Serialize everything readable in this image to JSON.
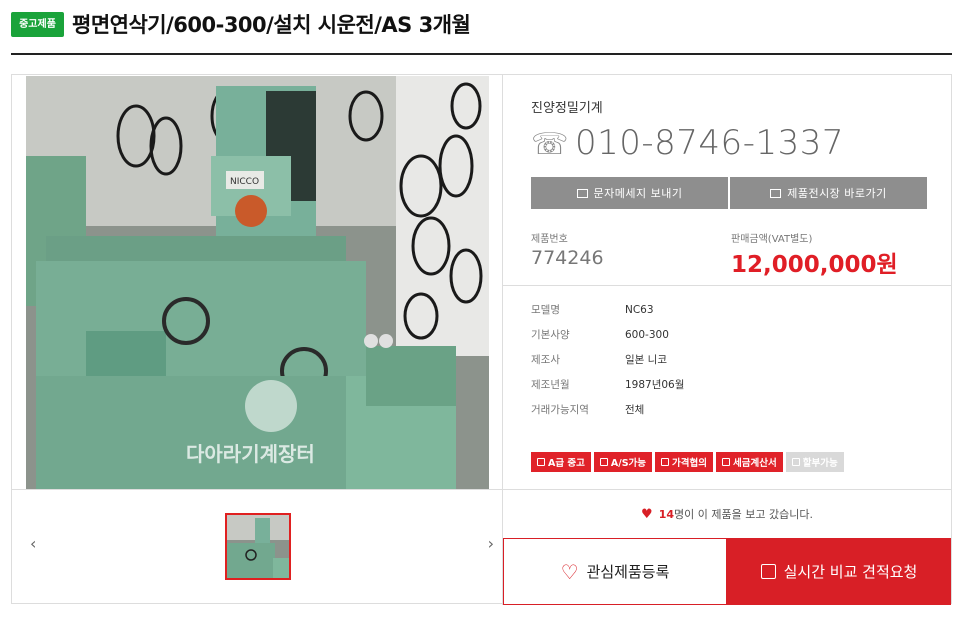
{
  "header": {
    "badge": "중고제품",
    "title": "평면연삭기/600-300/설치 시운전/AS 3개월"
  },
  "photo": {
    "watermark": "다아라기계장터",
    "nameplate": "NICCO"
  },
  "gallery": {
    "prev_icon": "chevron-left-icon",
    "next_icon": "chevron-right-icon"
  },
  "seller": {
    "name": "진양정밀기계",
    "phone": "010-8746-1337",
    "sms_label": "문자메세지 보내기",
    "shop_label": "제품전시장 바로가기"
  },
  "product": {
    "number_label": "제품번호",
    "number": "774246",
    "price_label": "판매금액(VAT별도)",
    "price": "12,000,000원"
  },
  "specs": [
    {
      "key": "모델명",
      "value": "NC63"
    },
    {
      "key": "기본사양",
      "value": "600-300"
    },
    {
      "key": "제조사",
      "value": "일본 니코"
    },
    {
      "key": "제조년월",
      "value": "1987년06월"
    },
    {
      "key": "거래가능지역",
      "value": "전체"
    }
  ],
  "tags": [
    "A급 중고",
    "A/S가능",
    "가격협의",
    "세금계산서",
    "할부가능"
  ],
  "views": {
    "count": "14",
    "text": "명이 이 제품을 보고 갔습니다."
  },
  "actions": {
    "wishlist": "관심제품등록",
    "quote": "실시간 비교 견적요청"
  },
  "colors": {
    "accent": "#d81f26",
    "badge": "#1aa33a",
    "button_gray": "#8e8e8e"
  }
}
